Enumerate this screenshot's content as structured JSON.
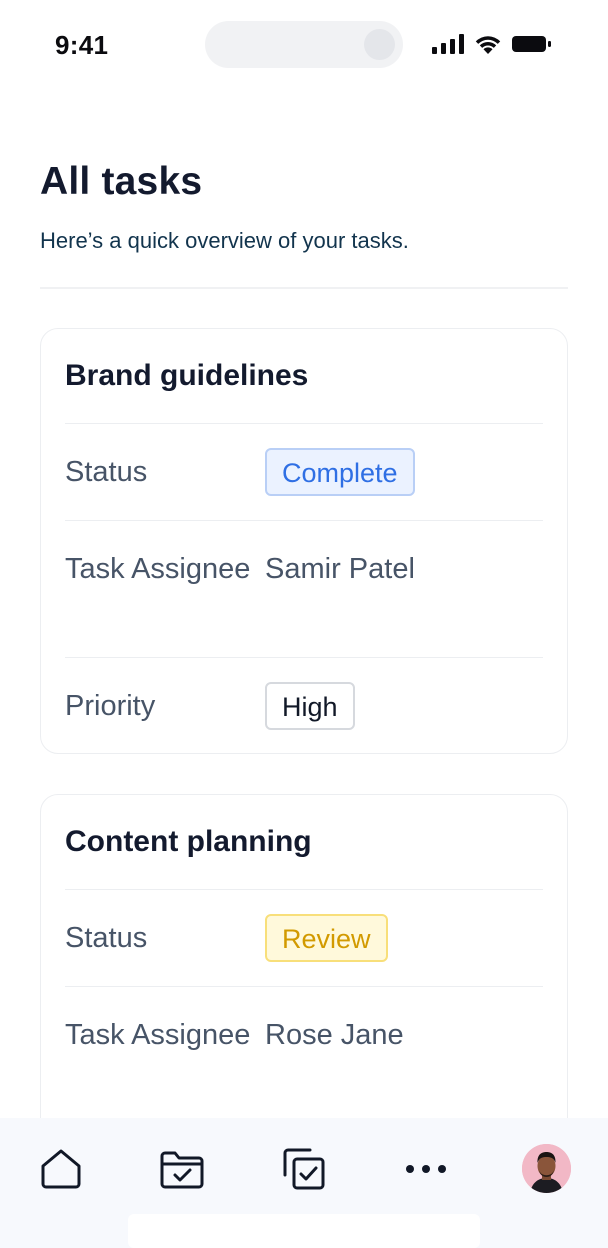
{
  "status_bar": {
    "time": "9:41"
  },
  "header": {
    "title": "All tasks",
    "subtitle": "Here’s a quick overview of your tasks."
  },
  "tasks": [
    {
      "title": "Brand guidelines",
      "status_label": "Status",
      "status": "Complete",
      "status_color": "#2f6fe4",
      "assignee_label": "Task Assignee",
      "assignee": "Samir Patel",
      "priority_label": "Priority",
      "priority": "High"
    },
    {
      "title": "Content planning",
      "status_label": "Status",
      "status": "Review",
      "status_color": "#d29a00",
      "assignee_label": "Task Assignee",
      "assignee": "Rose Jane"
    }
  ],
  "bottom_nav": {
    "items": [
      {
        "icon": "home-icon"
      },
      {
        "icon": "folder-check-icon"
      },
      {
        "icon": "tasks-check-icon"
      },
      {
        "icon": "more-icon"
      },
      {
        "icon": "avatar"
      }
    ]
  },
  "colors": {
    "title": "#131a2e",
    "subtitle": "#12344d",
    "label": "#475467",
    "nav_background": "#f7f9fd"
  }
}
